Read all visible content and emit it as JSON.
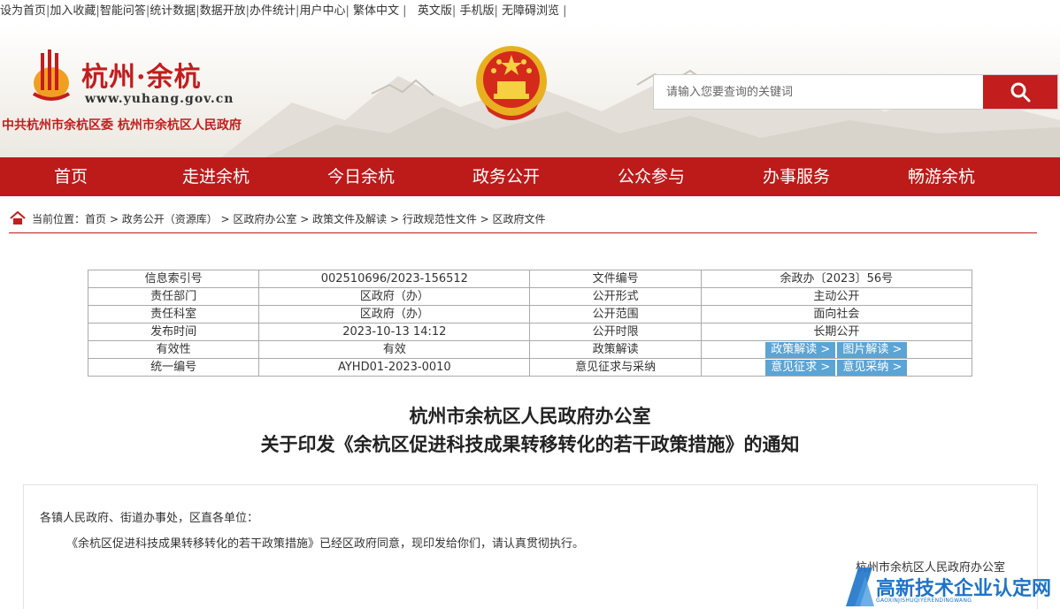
{
  "topbar": {
    "links": [
      "设为首页",
      "加入收藏",
      "智能问答",
      "统计数据",
      "数据开放",
      "办件统计",
      "用户中心",
      "繁体中文",
      "英文版",
      "手机版",
      "无障碍浏览"
    ]
  },
  "header": {
    "logo_title": "杭州·余杭",
    "logo_url": "www.yuhang.gov.cn",
    "subtitle": "中共杭州市余杭区委  杭州市余杭区人民政府",
    "search_placeholder": "请输入您要查询的关键词"
  },
  "nav": {
    "items": [
      "首页",
      "走进余杭",
      "今日余杭",
      "政务公开",
      "公众参与",
      "办事服务",
      "畅游余杭"
    ]
  },
  "breadcrumb": {
    "prefix": "当前位置：",
    "items": [
      "首页",
      "政务公开（资源库）",
      "区政府办公室",
      "政策文件及解读",
      "行政规范性文件",
      "区政府文件"
    ]
  },
  "info": {
    "index_label": "信息索引号",
    "index_value": "002510696/2023-156512",
    "docno_label": "文件编号",
    "docno_value": "余政办〔2023〕56号",
    "dept_label": "责任部门",
    "dept_value": "区政府（办）",
    "form_label": "公开形式",
    "form_value": "主动公开",
    "office_label": "责任科室",
    "office_value": "区政府（办）",
    "scope_label": "公开范围",
    "scope_value": "面向社会",
    "date_label": "发布时间",
    "date_value": "2023-10-13 14:12",
    "period_label": "公开时限",
    "period_value": "长期公开",
    "valid_label": "有效性",
    "valid_value": "有效",
    "interp_label": "政策解读",
    "interp_btn1": "政策解读 >",
    "interp_btn2": "图片解读 >",
    "code_label": "统一编号",
    "code_value": "AYHD01-2023-0010",
    "opinion_label": "意见征求与采纳",
    "opinion_btn1": "意见征求 >",
    "opinion_btn2": "意见采纳 >"
  },
  "document": {
    "title_line1": "杭州市余杭区人民政府办公室",
    "title_line2": "关于印发《余杭区促进科技成果转移转化的若干政策措施》的通知",
    "greeting": "各镇人民政府、街道办事处，区直各单位：",
    "body": "《余杭区促进科技成果转移转化的若干政策措施》已经区政府同意，现印发给你们，请认真贯彻执行。",
    "signature": "杭州市余杭区人民政府办公室"
  },
  "watermark": {
    "text": "高新技术企业认定网",
    "sub": "GAOXINJISHUQIYERENDINGWANG"
  },
  "colors": {
    "brand_red": "#bd1a1a",
    "pill_blue": "#5aa4d6",
    "watermark_blue": "#1e73c8"
  }
}
